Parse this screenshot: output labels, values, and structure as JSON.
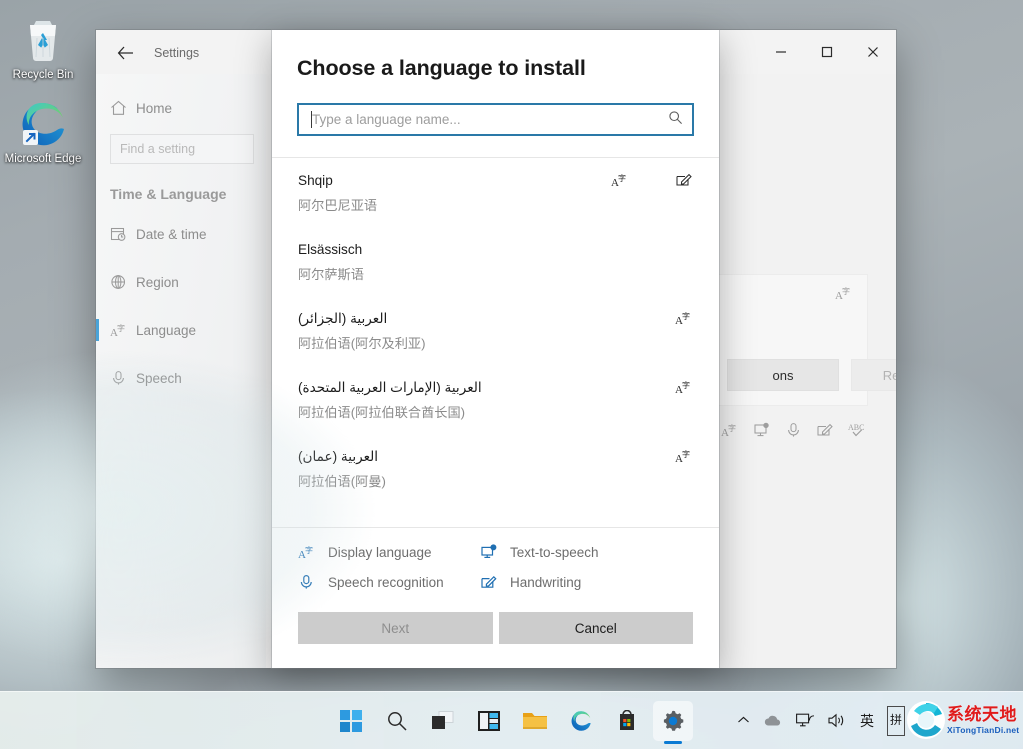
{
  "desktop": {
    "icons": [
      {
        "name": "recycle-bin",
        "label": "Recycle Bin"
      },
      {
        "name": "microsoft-edge",
        "label": "Microsoft Edge"
      }
    ]
  },
  "settings_window": {
    "title": "Settings",
    "back_icon": "back-arrow-icon",
    "window_controls": {
      "minimize": "—",
      "maximize": "☐",
      "close": "✕"
    },
    "sidebar": {
      "home_label": "Home",
      "home_icon": "home-icon",
      "search": {
        "placeholder": "Find a setting",
        "value": ""
      },
      "section_heading": "Time & Language",
      "items": [
        {
          "label": "Date & time",
          "icon": "calendar-clock-icon",
          "selected": false
        },
        {
          "label": "Region",
          "icon": "globe-icon",
          "selected": false
        },
        {
          "label": "Language",
          "icon": "display-language-icon",
          "selected": true
        },
        {
          "label": "Speech",
          "icon": "microphone-icon",
          "selected": false
        }
      ]
    },
    "content": {
      "card_icon": "display-language-icon",
      "options_button": "ons",
      "remove_button": "Remove",
      "feature_icons": [
        "display-language-icon",
        "text-to-speech-icon",
        "speech-recognition-icon",
        "handwriting-icon",
        "basic-typing-icon"
      ]
    }
  },
  "dialog": {
    "title": "Choose a language to install",
    "search": {
      "placeholder": "Type a language name...",
      "value": "",
      "icon": "search-icon"
    },
    "languages": [
      {
        "native": "Shqip",
        "translation": "阿尔巴尼亚语",
        "rtl": false,
        "icons": [
          "display-language-icon",
          "handwriting-icon"
        ]
      },
      {
        "native": "Elsässisch",
        "translation": "阿尔萨斯语",
        "rtl": false,
        "icons": []
      },
      {
        "native": "العربية (الجزائر)",
        "translation": "阿拉伯语(阿尔及利亚)",
        "rtl": true,
        "icons": [
          "display-language-icon"
        ]
      },
      {
        "native": "العربية (الإمارات العربية المتحدة)",
        "translation": "阿拉伯语(阿拉伯联合酋长国)",
        "rtl": true,
        "icons": [
          "display-language-icon"
        ]
      },
      {
        "native": "العربية (عمان)",
        "translation": "阿拉伯语(阿曼)",
        "rtl": true,
        "icons": [
          "display-language-icon"
        ]
      }
    ],
    "legend": [
      {
        "label": "Display language",
        "icon": "display-language-icon"
      },
      {
        "label": "Text-to-speech",
        "icon": "text-to-speech-icon"
      },
      {
        "label": "Speech recognition",
        "icon": "speech-recognition-icon"
      },
      {
        "label": "Handwriting",
        "icon": "handwriting-icon"
      }
    ],
    "actions": {
      "next": {
        "label": "Next",
        "enabled": false
      },
      "cancel": {
        "label": "Cancel",
        "enabled": true
      }
    }
  },
  "taskbar": {
    "items": [
      {
        "name": "start-button",
        "active": false
      },
      {
        "name": "search-icon",
        "active": false
      },
      {
        "name": "task-view-icon",
        "active": false
      },
      {
        "name": "widgets-icon",
        "active": false
      },
      {
        "name": "file-explorer-icon",
        "active": false
      },
      {
        "name": "microsoft-edge-icon",
        "active": false
      },
      {
        "name": "microsoft-store-icon",
        "active": false
      },
      {
        "name": "settings-icon",
        "active": true
      }
    ],
    "tray": {
      "chevron": "˄",
      "cloud_icon": "cloud-icon",
      "network_icon": "network-icon",
      "volume_icon": "volume-icon",
      "ime_language": "英",
      "ime_mode": "拼"
    },
    "watermark": {
      "main": "系统天地",
      "sub": "XiTongTianDi.net"
    }
  },
  "colors": {
    "accent": "#0a7ad3",
    "dialog_focus_border": "#2a79a8",
    "sidebar_selected": "#4aa3d8",
    "legend_icon": "#1f6fb2",
    "watermark_red": "#e01b1b",
    "watermark_blue": "#1b5fbd"
  }
}
